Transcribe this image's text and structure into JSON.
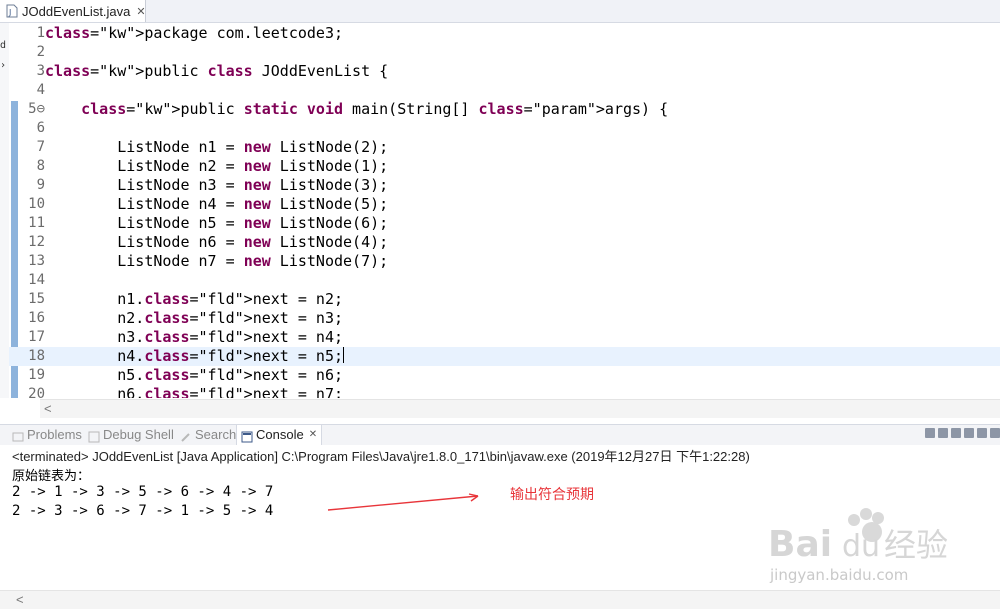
{
  "editor": {
    "tab_title": "JOddEvenList.java",
    "close_glyph": "✕",
    "gutter_marks": [
      "d",
      "›"
    ],
    "lines": [
      {
        "n": "1",
        "t": "package com.leetcode3;"
      },
      {
        "n": "2",
        "t": ""
      },
      {
        "n": "3",
        "t": "public class JOddEvenList {"
      },
      {
        "n": "4",
        "t": ""
      },
      {
        "n": "5⊖",
        "t": "    public static void main(String[] args) {"
      },
      {
        "n": "6",
        "t": ""
      },
      {
        "n": "7",
        "t": "        ListNode n1 = new ListNode(2);"
      },
      {
        "n": "8",
        "t": "        ListNode n2 = new ListNode(1);"
      },
      {
        "n": "9",
        "t": "        ListNode n3 = new ListNode(3);"
      },
      {
        "n": "10",
        "t": "        ListNode n4 = new ListNode(5);"
      },
      {
        "n": "11",
        "t": "        ListNode n5 = new ListNode(6);"
      },
      {
        "n": "12",
        "t": "        ListNode n6 = new ListNode(4);"
      },
      {
        "n": "13",
        "t": "        ListNode n7 = new ListNode(7);"
      },
      {
        "n": "14",
        "t": ""
      },
      {
        "n": "15",
        "t": "        n1.next = n2;"
      },
      {
        "n": "16",
        "t": "        n2.next = n3;"
      },
      {
        "n": "17",
        "t": "        n3.next = n4;"
      },
      {
        "n": "18",
        "t": "        n4.next = n5;"
      },
      {
        "n": "19",
        "t": "        n5.next = n6;"
      },
      {
        "n": "20",
        "t": "        n6.next = n7;"
      }
    ],
    "current_line": "18",
    "scroll_arrow": "<"
  },
  "console": {
    "tabs": [
      {
        "label": "Problems",
        "icon": "problems-icon",
        "active": false
      },
      {
        "label": "Debug Shell",
        "icon": "debug-shell-icon",
        "active": false
      },
      {
        "label": "Search",
        "icon": "search-icon",
        "active": false
      },
      {
        "label": "Console",
        "icon": "console-icon",
        "active": true
      }
    ],
    "tab_close_glyph": "✕",
    "terminated_line": "<terminated> JOddEvenList [Java Application] C:\\Program Files\\Java\\jre1.8.0_171\\bin\\javaw.exe (2019年12月27日 下午1:22:28)",
    "output": [
      "原始链表为：",
      "2 -> 1 -> 3 -> 5 -> 6 -> 4 -> 7",
      "2 -> 3 -> 6 -> 7 -> 1 -> 5 -> 4"
    ],
    "scroll_arrow": "<"
  },
  "annotation": {
    "text": "输出符合预期",
    "color": "#e8353a"
  },
  "watermark": {
    "brand": "Bai du 经验",
    "url": "jingyan.baidu.com"
  },
  "colors": {
    "keyword": "#7f0055",
    "field": "#0000c0",
    "current_line": "#e8f2fe"
  }
}
